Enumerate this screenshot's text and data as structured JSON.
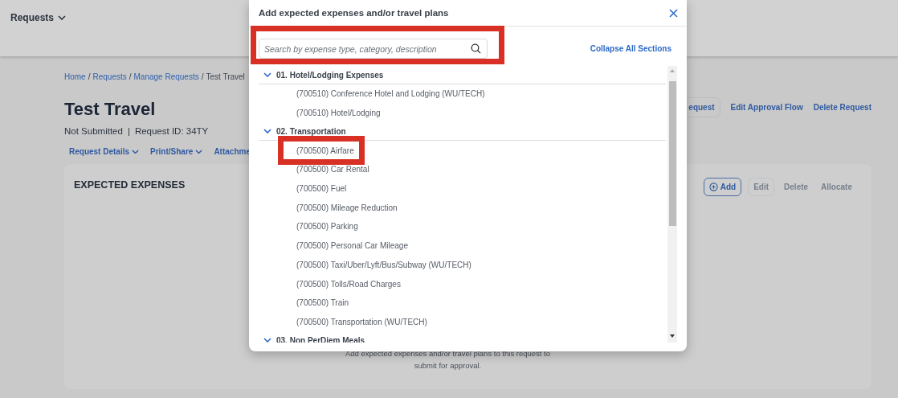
{
  "header": {
    "menu": "Requests"
  },
  "breadcrumb": [
    {
      "label": "Home",
      "kind": "link"
    },
    {
      "label": "/",
      "kind": "separator"
    },
    {
      "label": "Requests",
      "kind": "link"
    },
    {
      "label": "/",
      "kind": "separator"
    },
    {
      "label": "Manage Requests",
      "kind": "link"
    },
    {
      "label": "/",
      "kind": "separator"
    },
    {
      "label": "Test Travel",
      "kind": "current"
    }
  ],
  "title": "Test Travel",
  "status": "Not Submitted",
  "status_separator": "|",
  "request_id": "Request ID: 34TY",
  "menus": [
    "Request Details",
    "Print/Share",
    "Attachme"
  ],
  "actions": [
    {
      "label": "equest",
      "kind": "outlined"
    },
    {
      "label": "Edit Approval Flow",
      "kind": "link"
    },
    {
      "label": "Delete Request",
      "kind": "link"
    }
  ],
  "card": {
    "title": "EXPECTED EXPENSES",
    "buttons": [
      {
        "label": "Add",
        "kind": "add",
        "disabled": false
      },
      {
        "label": "Edit",
        "kind": "outlined",
        "disabled": true
      },
      {
        "label": "Delete",
        "kind": "plain",
        "disabled": true
      },
      {
        "label": "Allocate",
        "kind": "plain",
        "disabled": true
      }
    ],
    "empty_message": "Add expected expenses and/or travel plans to this request to submit for approval."
  },
  "modal": {
    "title": "Add expected expenses and/or travel plans",
    "search": {
      "placeholder": "Search by expense type, category, description",
      "highlighted": true
    },
    "collapse_link": "Collapse All Sections",
    "groups": [
      {
        "label": "01. Hotel/Lodging Expenses",
        "expanded": true,
        "items": [
          {
            "label": "(700510) Conference Hotel and Lodging (WU/TECH)",
            "highlighted": false
          },
          {
            "label": "(700510) Hotel/Lodging",
            "highlighted": false
          }
        ]
      },
      {
        "label": "02. Transportation",
        "expanded": true,
        "items": [
          {
            "label": "(700500) Airfare",
            "highlighted": true
          },
          {
            "label": "(700500) Car Rental",
            "highlighted": false
          },
          {
            "label": "(700500) Fuel",
            "highlighted": false
          },
          {
            "label": "(700500) Mileage Reduction",
            "highlighted": false
          },
          {
            "label": "(700500) Parking",
            "highlighted": false
          },
          {
            "label": "(700500) Personal Car Mileage",
            "highlighted": false
          },
          {
            "label": "(700500) Taxi/Uber/Lyft/Bus/Subway (WU/TECH)",
            "highlighted": false
          },
          {
            "label": "(700500) Tolls/Road Charges",
            "highlighted": false
          },
          {
            "label": "(700500) Train",
            "highlighted": false
          },
          {
            "label": "(700500) Transportation (WU/TECH)",
            "highlighted": false
          }
        ]
      },
      {
        "label": "03. Non PerDiem Meals",
        "expanded": true
      }
    ]
  }
}
